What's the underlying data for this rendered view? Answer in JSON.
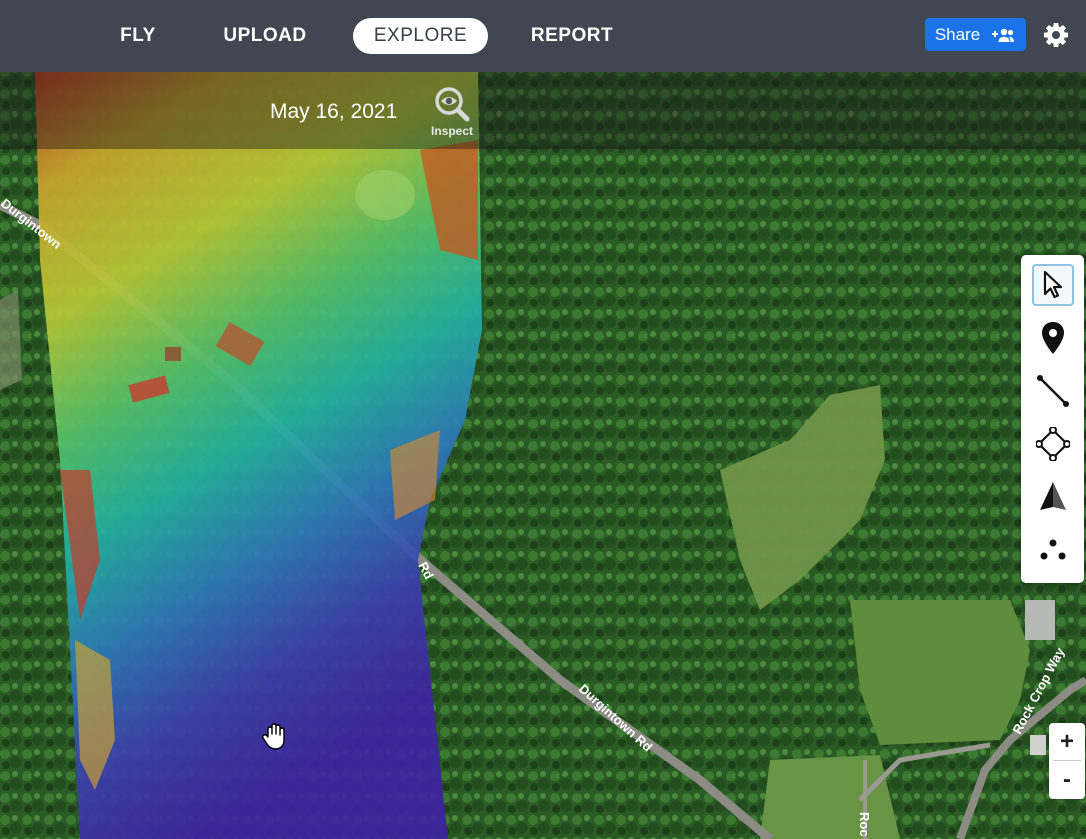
{
  "nav": {
    "tabs": [
      {
        "label": "FLY",
        "active": false
      },
      {
        "label": "UPLOAD",
        "active": false
      },
      {
        "label": "EXPLORE",
        "active": true
      },
      {
        "label": "REPORT",
        "active": false
      }
    ],
    "share_label": "Share",
    "share_icon": "add-person-icon",
    "settings_icon": "gear-icon"
  },
  "datebar": {
    "date": "May 16, 2021",
    "inspect_label": "Inspect",
    "inspect_icon": "magnifier-eye-icon"
  },
  "toolbox": {
    "tools": [
      {
        "name": "select",
        "icon": "cursor-arrow-icon",
        "selected": true
      },
      {
        "name": "location",
        "icon": "map-pin-icon",
        "selected": false
      },
      {
        "name": "distance",
        "icon": "line-measure-icon",
        "selected": false
      },
      {
        "name": "area",
        "icon": "polygon-icon",
        "selected": false
      },
      {
        "name": "volume",
        "icon": "pyramid-icon",
        "selected": false
      },
      {
        "name": "count",
        "icon": "dots-count-icon",
        "selected": false
      }
    ]
  },
  "zoom": {
    "in_label": "+",
    "out_label": "-"
  },
  "map": {
    "road_labels": [
      "Durgintown",
      "Rd",
      "Durgintown Rd",
      "Rock Crop Way",
      "Roc"
    ],
    "cursor": "hand-grab-icon"
  },
  "colors": {
    "topbar": "#414750",
    "share_blue": "#1a73e8",
    "forest": "#2f5a26",
    "field": "#6a8e45"
  }
}
